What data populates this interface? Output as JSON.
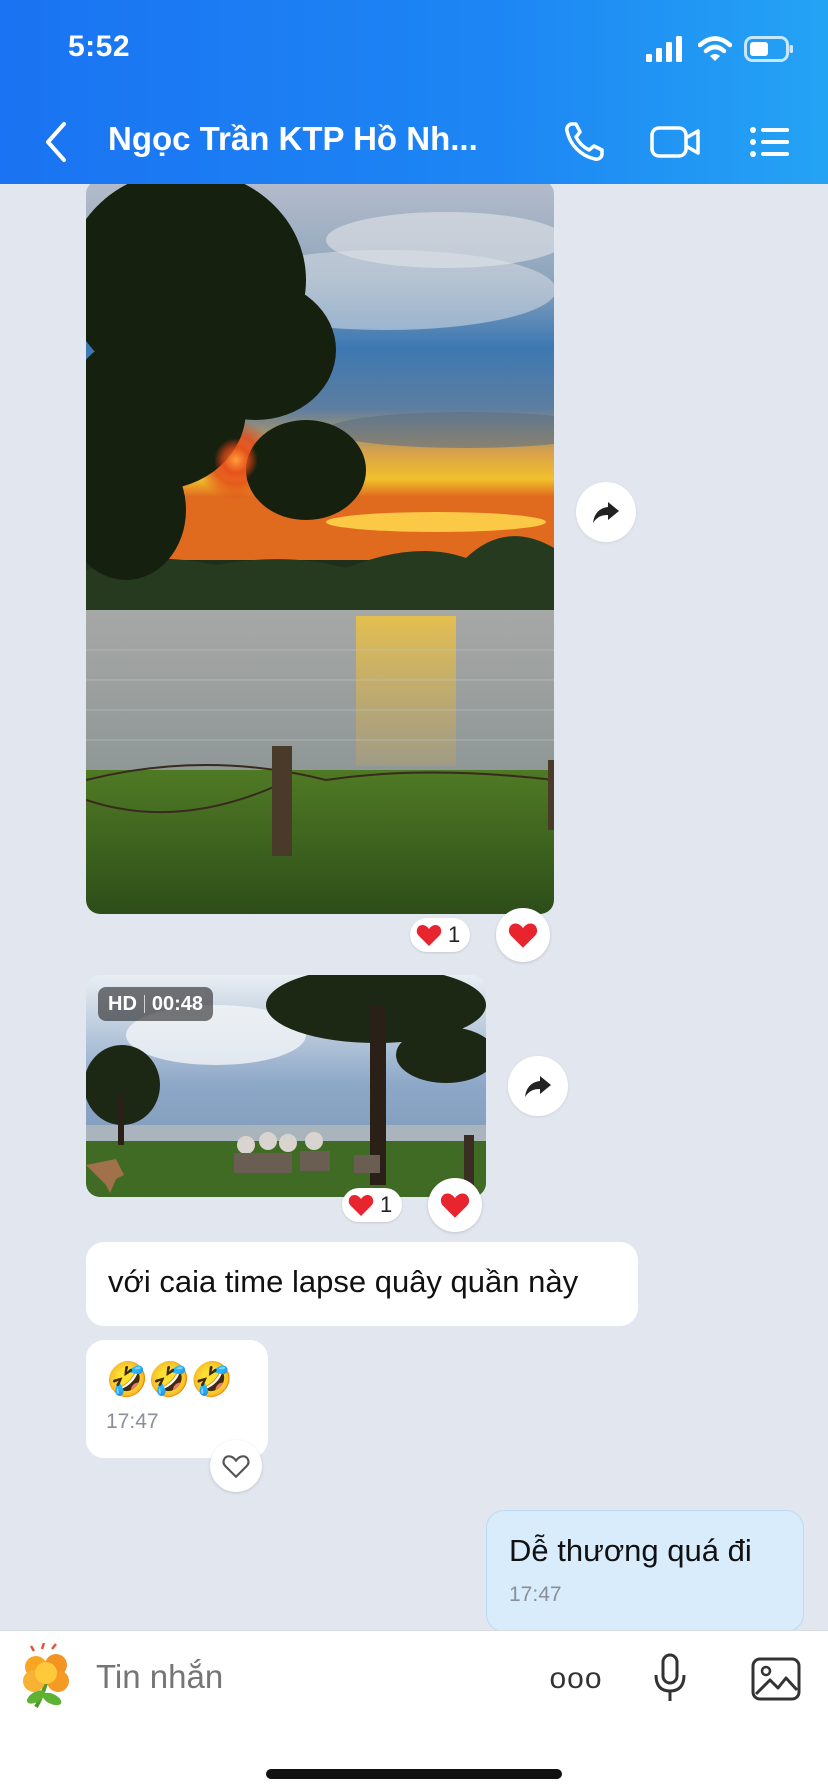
{
  "status_bar": {
    "time": "5:52"
  },
  "header": {
    "title": "Ngọc Trần KTP Hồ Nh..."
  },
  "messages": {
    "photo": {
      "reaction_count": "1"
    },
    "video": {
      "quality": "HD",
      "duration": "00:48",
      "reaction_count": "1"
    },
    "text1": {
      "text": "với caia time lapse quây quần này"
    },
    "emoji": {
      "text": "🤣🤣🤣",
      "time": "17:47"
    },
    "mine": {
      "text": "Dễ thương quá đi",
      "time": "17:47"
    }
  },
  "composer": {
    "placeholder": "Tin nhắn",
    "more_label": "ooo"
  },
  "colors": {
    "header_blue": "#1d86f4",
    "heart_red": "#e8242f",
    "chat_bg": "#e2e6ee",
    "my_bubble": "#d8ecfc"
  }
}
